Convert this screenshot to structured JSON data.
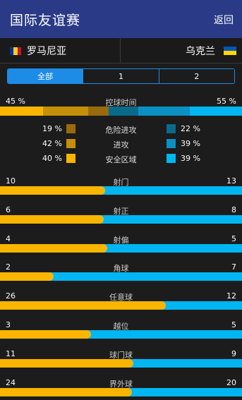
{
  "header": {
    "title": "国际友谊赛",
    "back_label": "返回"
  },
  "teams": {
    "home": {
      "name": "罗马尼亚",
      "flag_colors": [
        "#0033a0",
        "#fcd116",
        "#ce1126"
      ]
    },
    "away": {
      "name": "乌克兰",
      "flag_colors": [
        "#0057b7",
        "#ffd700"
      ]
    }
  },
  "tabs": [
    {
      "label": "全部",
      "active": true
    },
    {
      "label": "1",
      "active": false
    },
    {
      "label": "2",
      "active": false
    }
  ],
  "colors": {
    "home": "#f9b500",
    "away": "#00b6f2",
    "header": "#2a3a86",
    "tab_accent": "#1d8ce6"
  },
  "possession": {
    "label": "控球时间",
    "home_value": "45 %",
    "away_value": "55 %",
    "home_pct": 45,
    "away_pct": 55,
    "breakdown": [
      {
        "label": "危险进攻",
        "home": "19 %",
        "away": "22 %",
        "home_color": "#9a6b0c",
        "away_color": "#0a6a8c",
        "home_pct": 19,
        "away_pct": 22
      },
      {
        "label": "进攻",
        "home": "42 %",
        "away": "39 %",
        "home_color": "#c58f09",
        "away_color": "#0b90c4",
        "home_pct": 42,
        "away_pct": 39
      },
      {
        "label": "安全区域",
        "home": "40 %",
        "away": "39 %",
        "home_color": "#f9b500",
        "away_color": "#00b6f2",
        "home_pct": 40,
        "away_pct": 39
      }
    ]
  },
  "stats": [
    {
      "label": "射门",
      "home": "10",
      "away": "13",
      "home_num": 10,
      "away_num": 13
    },
    {
      "label": "射正",
      "home": "6",
      "away": "8",
      "home_num": 6,
      "away_num": 8
    },
    {
      "label": "射偏",
      "home": "4",
      "away": "5",
      "home_num": 4,
      "away_num": 5
    },
    {
      "label": "角球",
      "home": "2",
      "away": "7",
      "home_num": 2,
      "away_num": 7
    },
    {
      "label": "任意球",
      "home": "26",
      "away": "12",
      "home_num": 26,
      "away_num": 12
    },
    {
      "label": "越位",
      "home": "3",
      "away": "5",
      "home_num": 3,
      "away_num": 5
    },
    {
      "label": "球门球",
      "home": "11",
      "away": "9",
      "home_num": 11,
      "away_num": 9
    },
    {
      "label": "界外球",
      "home": "24",
      "away": "20",
      "home_num": 24,
      "away_num": 20
    }
  ]
}
